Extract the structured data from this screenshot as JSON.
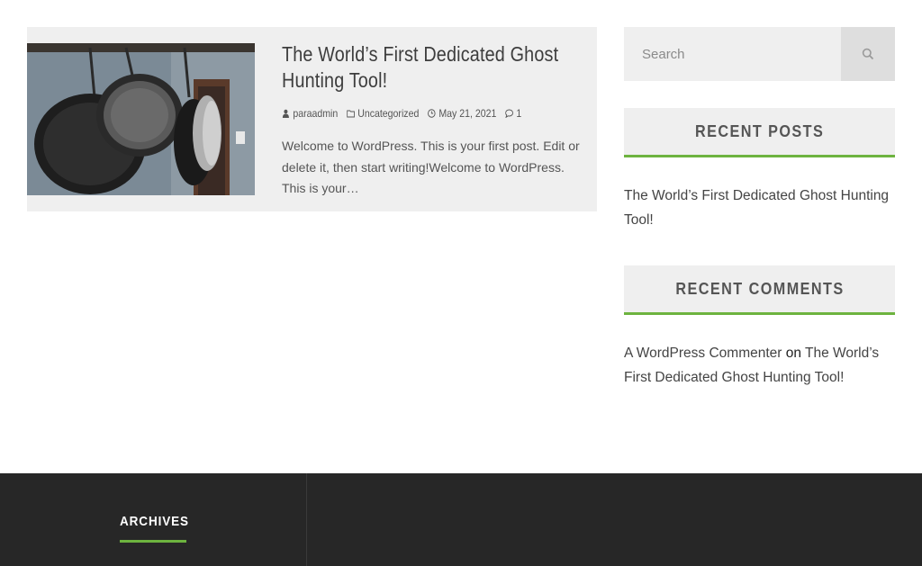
{
  "post": {
    "title": "The World’s First Dedicated Ghost Hunting Tool!",
    "author": "paraadmin",
    "category": "Uncategorized",
    "date": "May 21, 2021",
    "comments_count": "1",
    "excerpt": "Welcome to WordPress. This is your first post. Edit or delete it, then start writing!Welcome to WordPress. This is your…",
    "thumbnail_icon": "cast-iron-pans-photo"
  },
  "sidebar": {
    "search": {
      "placeholder": "Search",
      "button_icon": "search-icon"
    },
    "recent_posts": {
      "title": "RECENT POSTS",
      "items": [
        "The World’s First Dedicated Ghost Hunting Tool!"
      ]
    },
    "recent_comments": {
      "title": "RECENT COMMENTS",
      "author": "A WordPress Commenter",
      "connector": "on",
      "post": "The World’s First Dedicated Ghost Hunting Tool!"
    }
  },
  "footer": {
    "archives_title": "ARCHIVES"
  },
  "colors": {
    "accent": "#6db33f",
    "card_bg": "#efefef",
    "footer_bg": "#272727"
  }
}
